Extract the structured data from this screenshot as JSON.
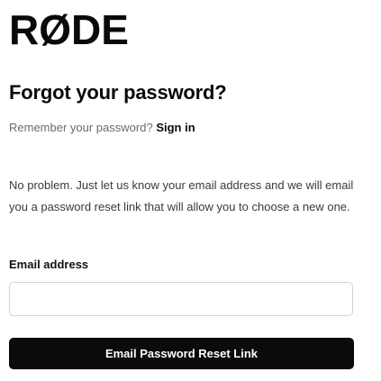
{
  "brand": {
    "logo_text": "RØDE"
  },
  "page": {
    "title": "Forgot your password?"
  },
  "signin_prompt": {
    "text": "Remember your password?",
    "link_label": "Sign in"
  },
  "explanation": "No problem. Just let us know your email address and we will email you a password reset link that will allow you to choose a new one.",
  "form": {
    "email_label": "Email address",
    "email_value": "",
    "email_placeholder": "",
    "submit_label": "Email Password Reset Link"
  },
  "colors": {
    "button_background": "#0b0b0b",
    "button_text": "#ffffff",
    "muted_text": "#6b6b6b",
    "input_border": "#d4d4d4"
  }
}
